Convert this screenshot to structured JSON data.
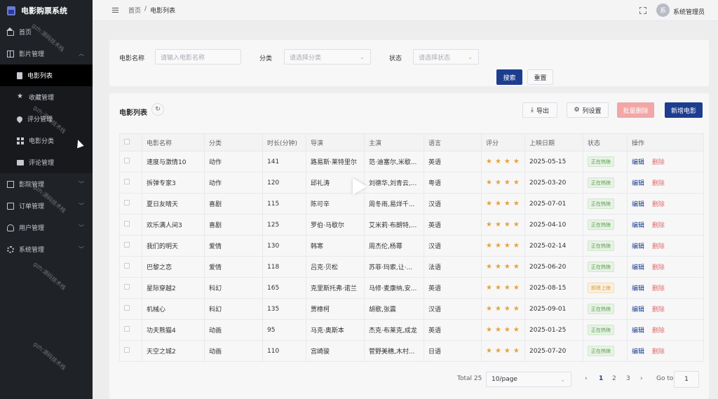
{
  "app": {
    "title": "电影购票系统"
  },
  "sidebar": {
    "items": [
      {
        "label": "首页",
        "icon": "home-icon"
      },
      {
        "label": "影片管理",
        "icon": "grid-icon",
        "expanded": true,
        "children": [
          {
            "label": "电影列表",
            "icon": "doc-icon",
            "active": true
          },
          {
            "label": "收藏管理",
            "icon": "star-icon"
          },
          {
            "label": "评分管理",
            "icon": "drop-icon"
          },
          {
            "label": "电影分类",
            "icon": "category-icon"
          },
          {
            "label": "评论管理",
            "icon": "chat-icon"
          }
        ]
      },
      {
        "label": "影院管理",
        "icon": "building-icon"
      },
      {
        "label": "订单管理",
        "icon": "order-icon"
      },
      {
        "label": "用户管理",
        "icon": "user-icon"
      },
      {
        "label": "系统管理",
        "icon": "gear-icon"
      }
    ]
  },
  "header": {
    "breadcrumb": [
      "首页",
      "电影列表"
    ],
    "separator": "/",
    "avatar_text": "系",
    "username": "系统管理员"
  },
  "search": {
    "name_label": "电影名称",
    "name_placeholder": "请输入电影名称",
    "category_label": "分类",
    "category_placeholder": "请选择分类",
    "status_label": "状态",
    "status_placeholder": "请选择状态",
    "search_btn": "搜索",
    "reset_btn": "重置"
  },
  "table_card": {
    "title": "电影列表",
    "export_btn": "导出",
    "columns_btn": "列设置",
    "batch_delete_btn": "批量删除",
    "add_btn": "新增电影"
  },
  "table": {
    "columns": [
      "电影名称",
      "分类",
      "时长(分钟)",
      "导演",
      "主演",
      "语言",
      "评分",
      "上映日期",
      "状态",
      "操作"
    ],
    "rows": [
      {
        "name": "速度与激情10",
        "category": "动作",
        "duration": "141",
        "director": "路易斯·莱特里尔",
        "cast": "范·迪塞尔,米歇...",
        "language": "英语",
        "stars": 4,
        "date": "2025-05-15",
        "status": "正在热映",
        "status_type": "green"
      },
      {
        "name": "拆弹专家3",
        "category": "动作",
        "duration": "120",
        "director": "邱礼涛",
        "cast": "刘德华,刘青云,...",
        "language": "粤语",
        "stars": 4,
        "date": "2025-03-20",
        "status": "正在热映",
        "status_type": "green"
      },
      {
        "name": "夏日友晴天",
        "category": "喜剧",
        "duration": "115",
        "director": "陈可辛",
        "cast": "周冬雨,易烊千...",
        "language": "汉语",
        "stars": 4,
        "date": "2025-07-01",
        "status": "正在热映",
        "status_type": "green"
      },
      {
        "name": "欢乐满人间3",
        "category": "喜剧",
        "duration": "125",
        "director": "罗伯·马歇尔",
        "cast": "艾米莉·布朗特,...",
        "language": "英语",
        "stars": 4,
        "date": "2025-04-10",
        "status": "正在热映",
        "status_type": "green"
      },
      {
        "name": "我们的明天",
        "category": "爱情",
        "duration": "130",
        "director": "韩寒",
        "cast": "周杰伦,杨幂",
        "language": "汉语",
        "stars": 4,
        "date": "2025-02-14",
        "status": "正在热映",
        "status_type": "green"
      },
      {
        "name": "巴黎之恋",
        "category": "爱情",
        "duration": "118",
        "director": "吕克·贝松",
        "cast": "苏菲·玛索,让·...",
        "language": "法语",
        "stars": 4,
        "date": "2025-06-20",
        "status": "正在热映",
        "status_type": "green"
      },
      {
        "name": "星际穿越2",
        "category": "科幻",
        "duration": "165",
        "director": "克里斯托弗·诺兰",
        "cast": "马修·麦康纳,安...",
        "language": "英语",
        "stars": 4,
        "date": "2025-08-15",
        "status": "即将上映",
        "status_type": "orange"
      },
      {
        "name": "机械心",
        "category": "科幻",
        "duration": "135",
        "director": "贾樟柯",
        "cast": "胡歌,张震",
        "language": "汉语",
        "stars": 4,
        "date": "2025-09-01",
        "status": "正在热映",
        "status_type": "green"
      },
      {
        "name": "功夫熊猫4",
        "category": "动画",
        "duration": "95",
        "director": "马克·奥斯本",
        "cast": "杰克·布莱克,成龙",
        "language": "英语",
        "stars": 4,
        "date": "2025-01-25",
        "status": "正在热映",
        "status_type": "green"
      },
      {
        "name": "天空之城2",
        "category": "动画",
        "duration": "110",
        "director": "宫崎骏",
        "cast": "菅野美穗,木村...",
        "language": "日语",
        "stars": 4,
        "date": "2025-07-20",
        "status": "正在热映",
        "status_type": "green"
      }
    ],
    "edit_label": "编辑",
    "delete_label": "删除"
  },
  "pagination": {
    "total": "Total 25",
    "page_size": "10/page",
    "pages": [
      "1",
      "2",
      "3"
    ],
    "current": "1",
    "goto_label": "Go to",
    "goto_value": "1",
    "prev": "‹",
    "next": "›"
  },
  "watermark": "gzh:源码技术栈",
  "colors": {
    "primary": "#1d3d8f",
    "danger": "#e06a6a",
    "sidebar": "#1f2227",
    "star": "#e6a23c"
  }
}
